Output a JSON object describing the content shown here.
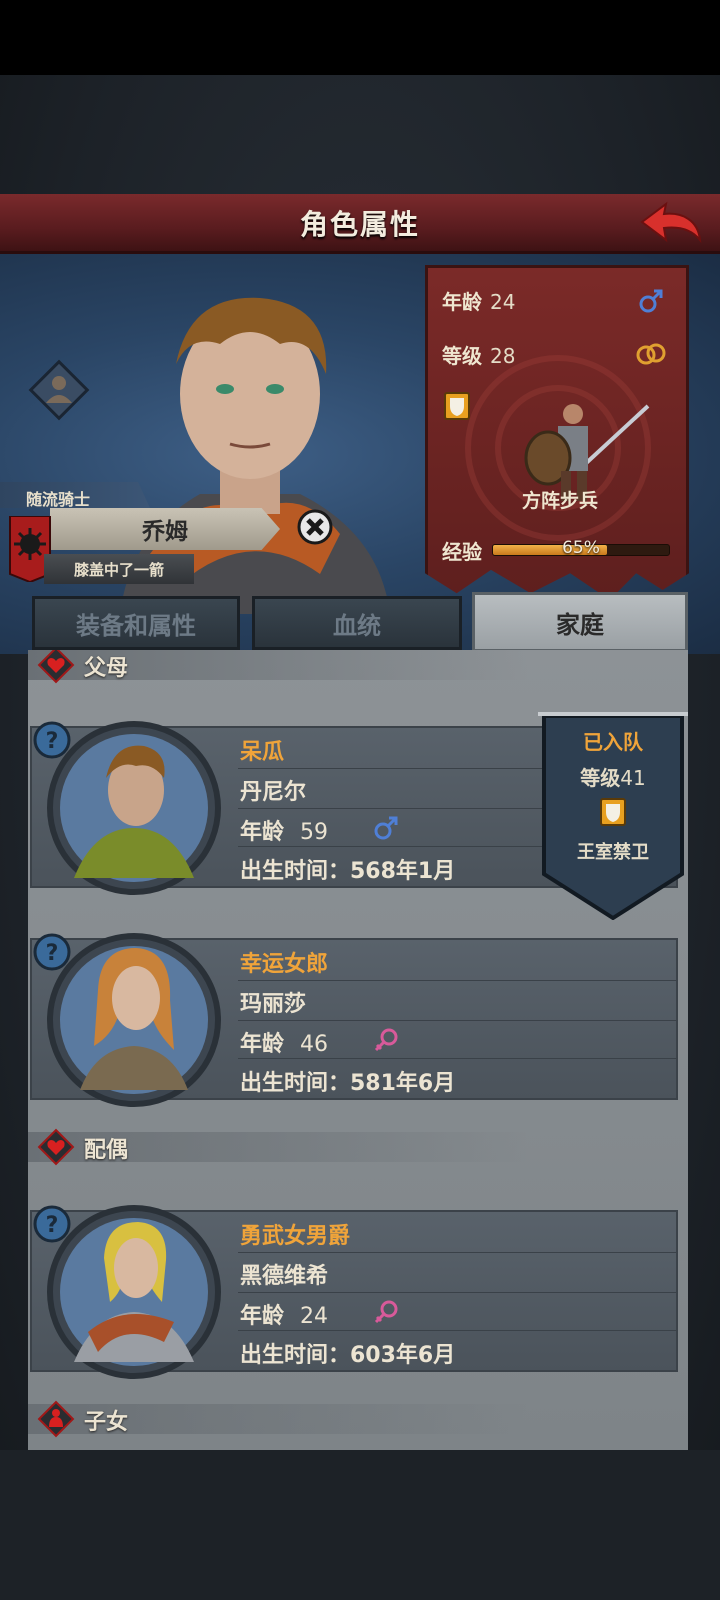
{
  "screen": {
    "title": "角色属性"
  },
  "hero": {
    "class_label": "随流骑士",
    "name": "乔姆",
    "trait": "膝盖中了一箭"
  },
  "stats": {
    "age_label": "年龄",
    "age_value": "24",
    "level_label": "等级",
    "level_value": "28",
    "unit_name": "方阵步兵",
    "exp_label": "经验",
    "exp_percent": 65,
    "exp_text": "65%",
    "colors": {
      "banner": "#7b2a28",
      "exp_fill": "#f2b24a"
    }
  },
  "tabs": [
    {
      "label": "装备和属性",
      "active": false
    },
    {
      "label": "血统",
      "active": false
    },
    {
      "label": "家庭",
      "active": true
    }
  ],
  "sections": {
    "parents": "父母",
    "spouse": "配偶",
    "children": "子女"
  },
  "members": [
    {
      "title": "呆瓜",
      "name": "丹尼尔",
      "age_label": "年龄",
      "age": "59",
      "gender": "male-icon",
      "born": "出生时间：568年1月"
    },
    {
      "title": "幸运女郎",
      "name": "玛丽莎",
      "age_label": "年龄",
      "age": "46",
      "gender": "female-icon",
      "born": "出生时间：581年6月"
    },
    {
      "title": "勇武女男爵",
      "name": "黑德维希",
      "age_label": "年龄",
      "age": "24",
      "gender": "female-icon",
      "born": "出生时间：603年6月"
    }
  ],
  "recruit": {
    "status": "已入队",
    "level_label": "等级",
    "level_value": "41",
    "unit": "王室禁卫"
  }
}
